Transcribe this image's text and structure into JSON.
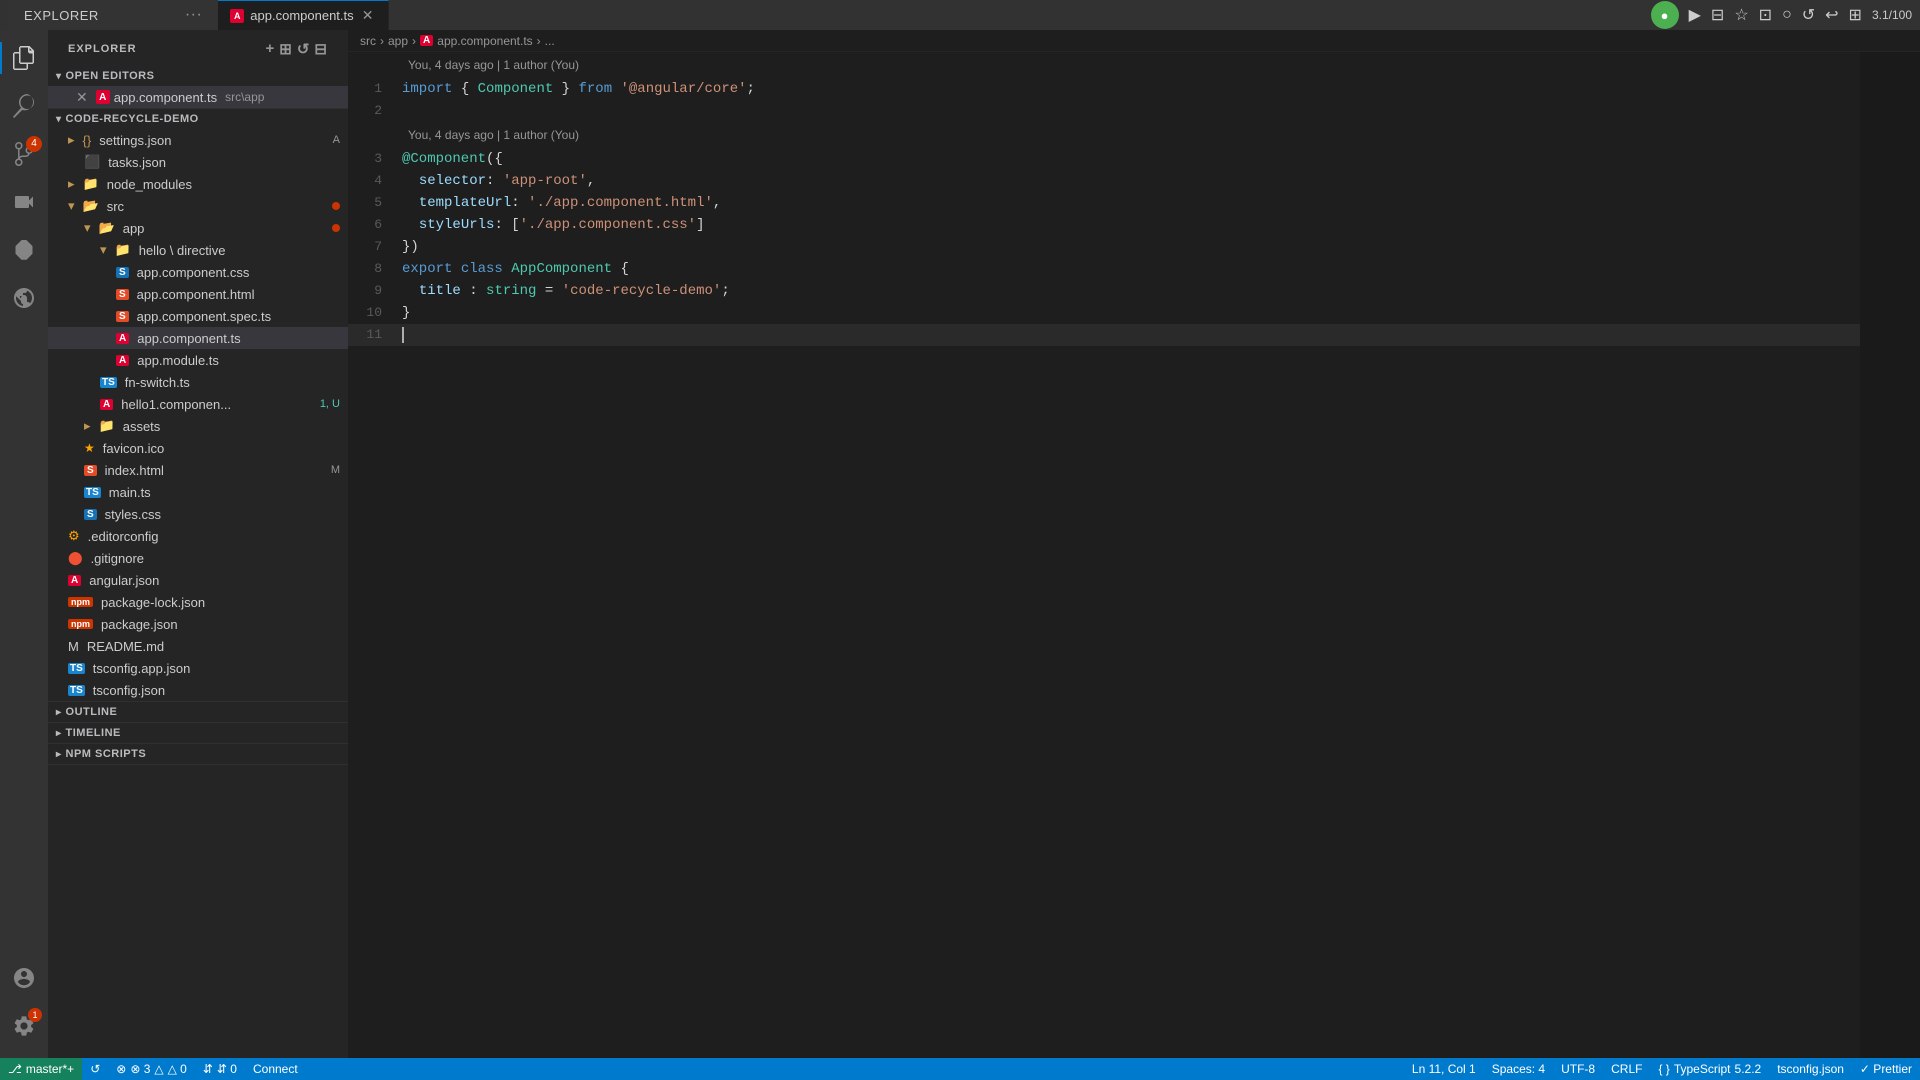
{
  "titlebar": {
    "tab_name": "app.component.ts",
    "explorer_label": "EXPLORER",
    "explorer_menu": "···"
  },
  "breadcrumb": {
    "src": "src",
    "arrow1": "›",
    "app": "app",
    "arrow2": "›",
    "icon": "A",
    "file": "app.component.ts",
    "arrow3": "›",
    "dots": "..."
  },
  "git_info_1": "You, 4 days ago | 1 author (You)",
  "git_info_2": "You, 4 days ago | 1 author (You)",
  "code": {
    "line1": "import { Component } from '@angular/core';",
    "line3": "@Component({",
    "line4": "  selector: 'app-root',",
    "line5": "  templateUrl: './app.component.html',",
    "line6": "  styleUrls: ['./app.component.css']",
    "line7": "})",
    "line8": "export class AppComponent {",
    "line9": "  title : string = 'code-recycle-demo';",
    "line10": "}"
  },
  "sidebar": {
    "open_editors_label": "OPEN EDITORS",
    "open_file": "app.component.ts",
    "open_file_path": "src\\app",
    "project_label": "CODE-RECYCLE-DEMO",
    "settings_json": "settings.json",
    "settings_badge": "A",
    "tasks_json": "tasks.json",
    "node_modules": "node_modules",
    "src": "src",
    "app": "app",
    "hello_directive": "hello \\ directive",
    "app_component_css": "app.component.css",
    "app_component_html": "app.component.html",
    "app_component_spec": "app.component.spec.ts",
    "app_component_ts": "app.component.ts",
    "app_module_ts": "app.module.ts",
    "fn_switch": "fn-switch.ts",
    "hello1_component": "hello1.componen...",
    "hello1_badge": "1, U",
    "assets": "assets",
    "favicon": "favicon.ico",
    "index_html": "index.html",
    "index_badge": "M",
    "main_ts": "main.ts",
    "styles_css": "styles.css",
    "editorconfig": ".editorconfig",
    "gitignore": ".gitignore",
    "angular_json": "angular.json",
    "package_lock": "package-lock.json",
    "package_json": "package.json",
    "readme": "README.md",
    "tsconfig_app": "tsconfig.app.json",
    "tsconfig": "tsconfig.json"
  },
  "outline_label": "OUTLINE",
  "timeline_label": "TIMELINE",
  "npm_scripts_label": "NPM SCRIPTS",
  "statusbar": {
    "branch": "master*+",
    "sync": "↺",
    "errors": "⊗ 3",
    "warnings": "△ 0",
    "port": "⇵ 0",
    "connect": "Connect",
    "ln_col": "Ln 11, Col 1",
    "spaces": "Spaces: 4",
    "encoding": "UTF-8",
    "line_ending": "CRLF",
    "language": "TypeScript",
    "version": "5.2.2",
    "tsconfig": "tsconfig.json",
    "prettier": "✓ Prettier",
    "version2": "3.1/100"
  }
}
